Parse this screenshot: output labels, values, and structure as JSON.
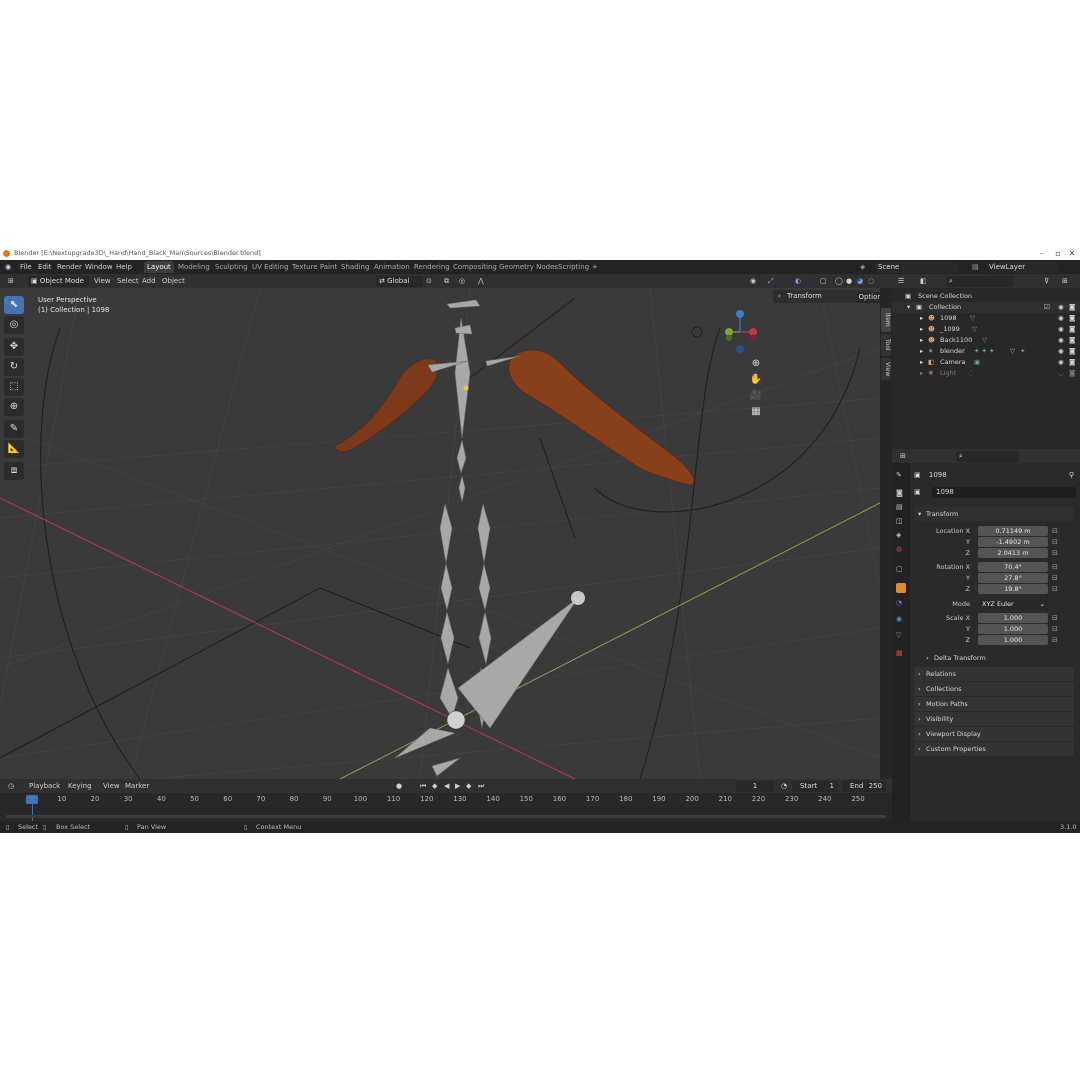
{
  "window": {
    "title": "Blender [E:\\Nextupgrade3D\\_Hand\\Hand_Black_Man\\Sources\\Blender.blend]"
  },
  "menu": [
    "File",
    "Edit",
    "Render",
    "Window",
    "Help"
  ],
  "workspaces": [
    "Layout",
    "Modeling",
    "Sculpting",
    "UV Editing",
    "Texture Paint",
    "Shading",
    "Animation",
    "Rendering",
    "Compositing",
    "Geometry Nodes",
    "Scripting"
  ],
  "workspace_add": "+",
  "scene": {
    "label": "Scene",
    "viewlayer": "ViewLayer"
  },
  "viewport_header": {
    "mode": "Object Mode",
    "menus": [
      "View",
      "Select",
      "Add",
      "Object"
    ],
    "orientation": "Global",
    "options": "Options"
  },
  "viewport": {
    "perspective": "User Perspective",
    "collection_info": "(1) Collection | 1098",
    "npanel_header": "Transform",
    "npanel_tabs": [
      "Item",
      "Tool",
      "View"
    ],
    "gizmo_axes": [
      "Z",
      "Y",
      "X"
    ]
  },
  "outliner": {
    "root": "Scene Collection",
    "collection": "Collection",
    "items": [
      {
        "name": "1098"
      },
      {
        "name": "_1099"
      },
      {
        "name": "Back1100"
      },
      {
        "name": "blender"
      },
      {
        "name": "Camera"
      },
      {
        "name": "Light"
      }
    ]
  },
  "properties": {
    "object_name": "1098",
    "data_name": "1098",
    "transform_label": "Transform",
    "location_label": "Location X",
    "location": [
      "0.71149 m",
      "-1.4902 m",
      "2.0413 m"
    ],
    "rotation_label": "Rotation X",
    "rotation": [
      "70.4°",
      "27.8°",
      "19.8°"
    ],
    "mode_label": "Mode",
    "mode_value": "XYZ Euler",
    "scale_label": "Scale X",
    "scale": [
      "1.000",
      "1.000",
      "1.000"
    ],
    "axis_y": "Y",
    "axis_z": "Z",
    "delta_transform": "Delta Transform",
    "panels": [
      "Relations",
      "Collections",
      "Motion Paths",
      "Visibility",
      "Viewport Display",
      "Custom Properties"
    ]
  },
  "timeline": {
    "menus": [
      "Playback",
      "Keying",
      "View",
      "Marker"
    ],
    "current_frame": "1",
    "start_label": "Start",
    "start": "1",
    "end_label": "End",
    "end": "250",
    "ticks": [
      "1",
      "10",
      "20",
      "30",
      "40",
      "50",
      "60",
      "70",
      "80",
      "90",
      "100",
      "110",
      "120",
      "130",
      "140",
      "150",
      "160",
      "170",
      "180",
      "190",
      "200",
      "210",
      "220",
      "230",
      "240",
      "250"
    ]
  },
  "statusbar": {
    "select": "Select",
    "box_select": "Box Select",
    "pan_view": "Pan View",
    "context_menu": "Context Menu",
    "version": "3.1.0"
  },
  "colors": {
    "accent": "#4772b3",
    "skin": "#8a3f1c",
    "bone": "#a8a8a8",
    "x_axis": "#c0394b",
    "y_axis": "#7fa83a",
    "z_axis": "#3d7fd6"
  }
}
